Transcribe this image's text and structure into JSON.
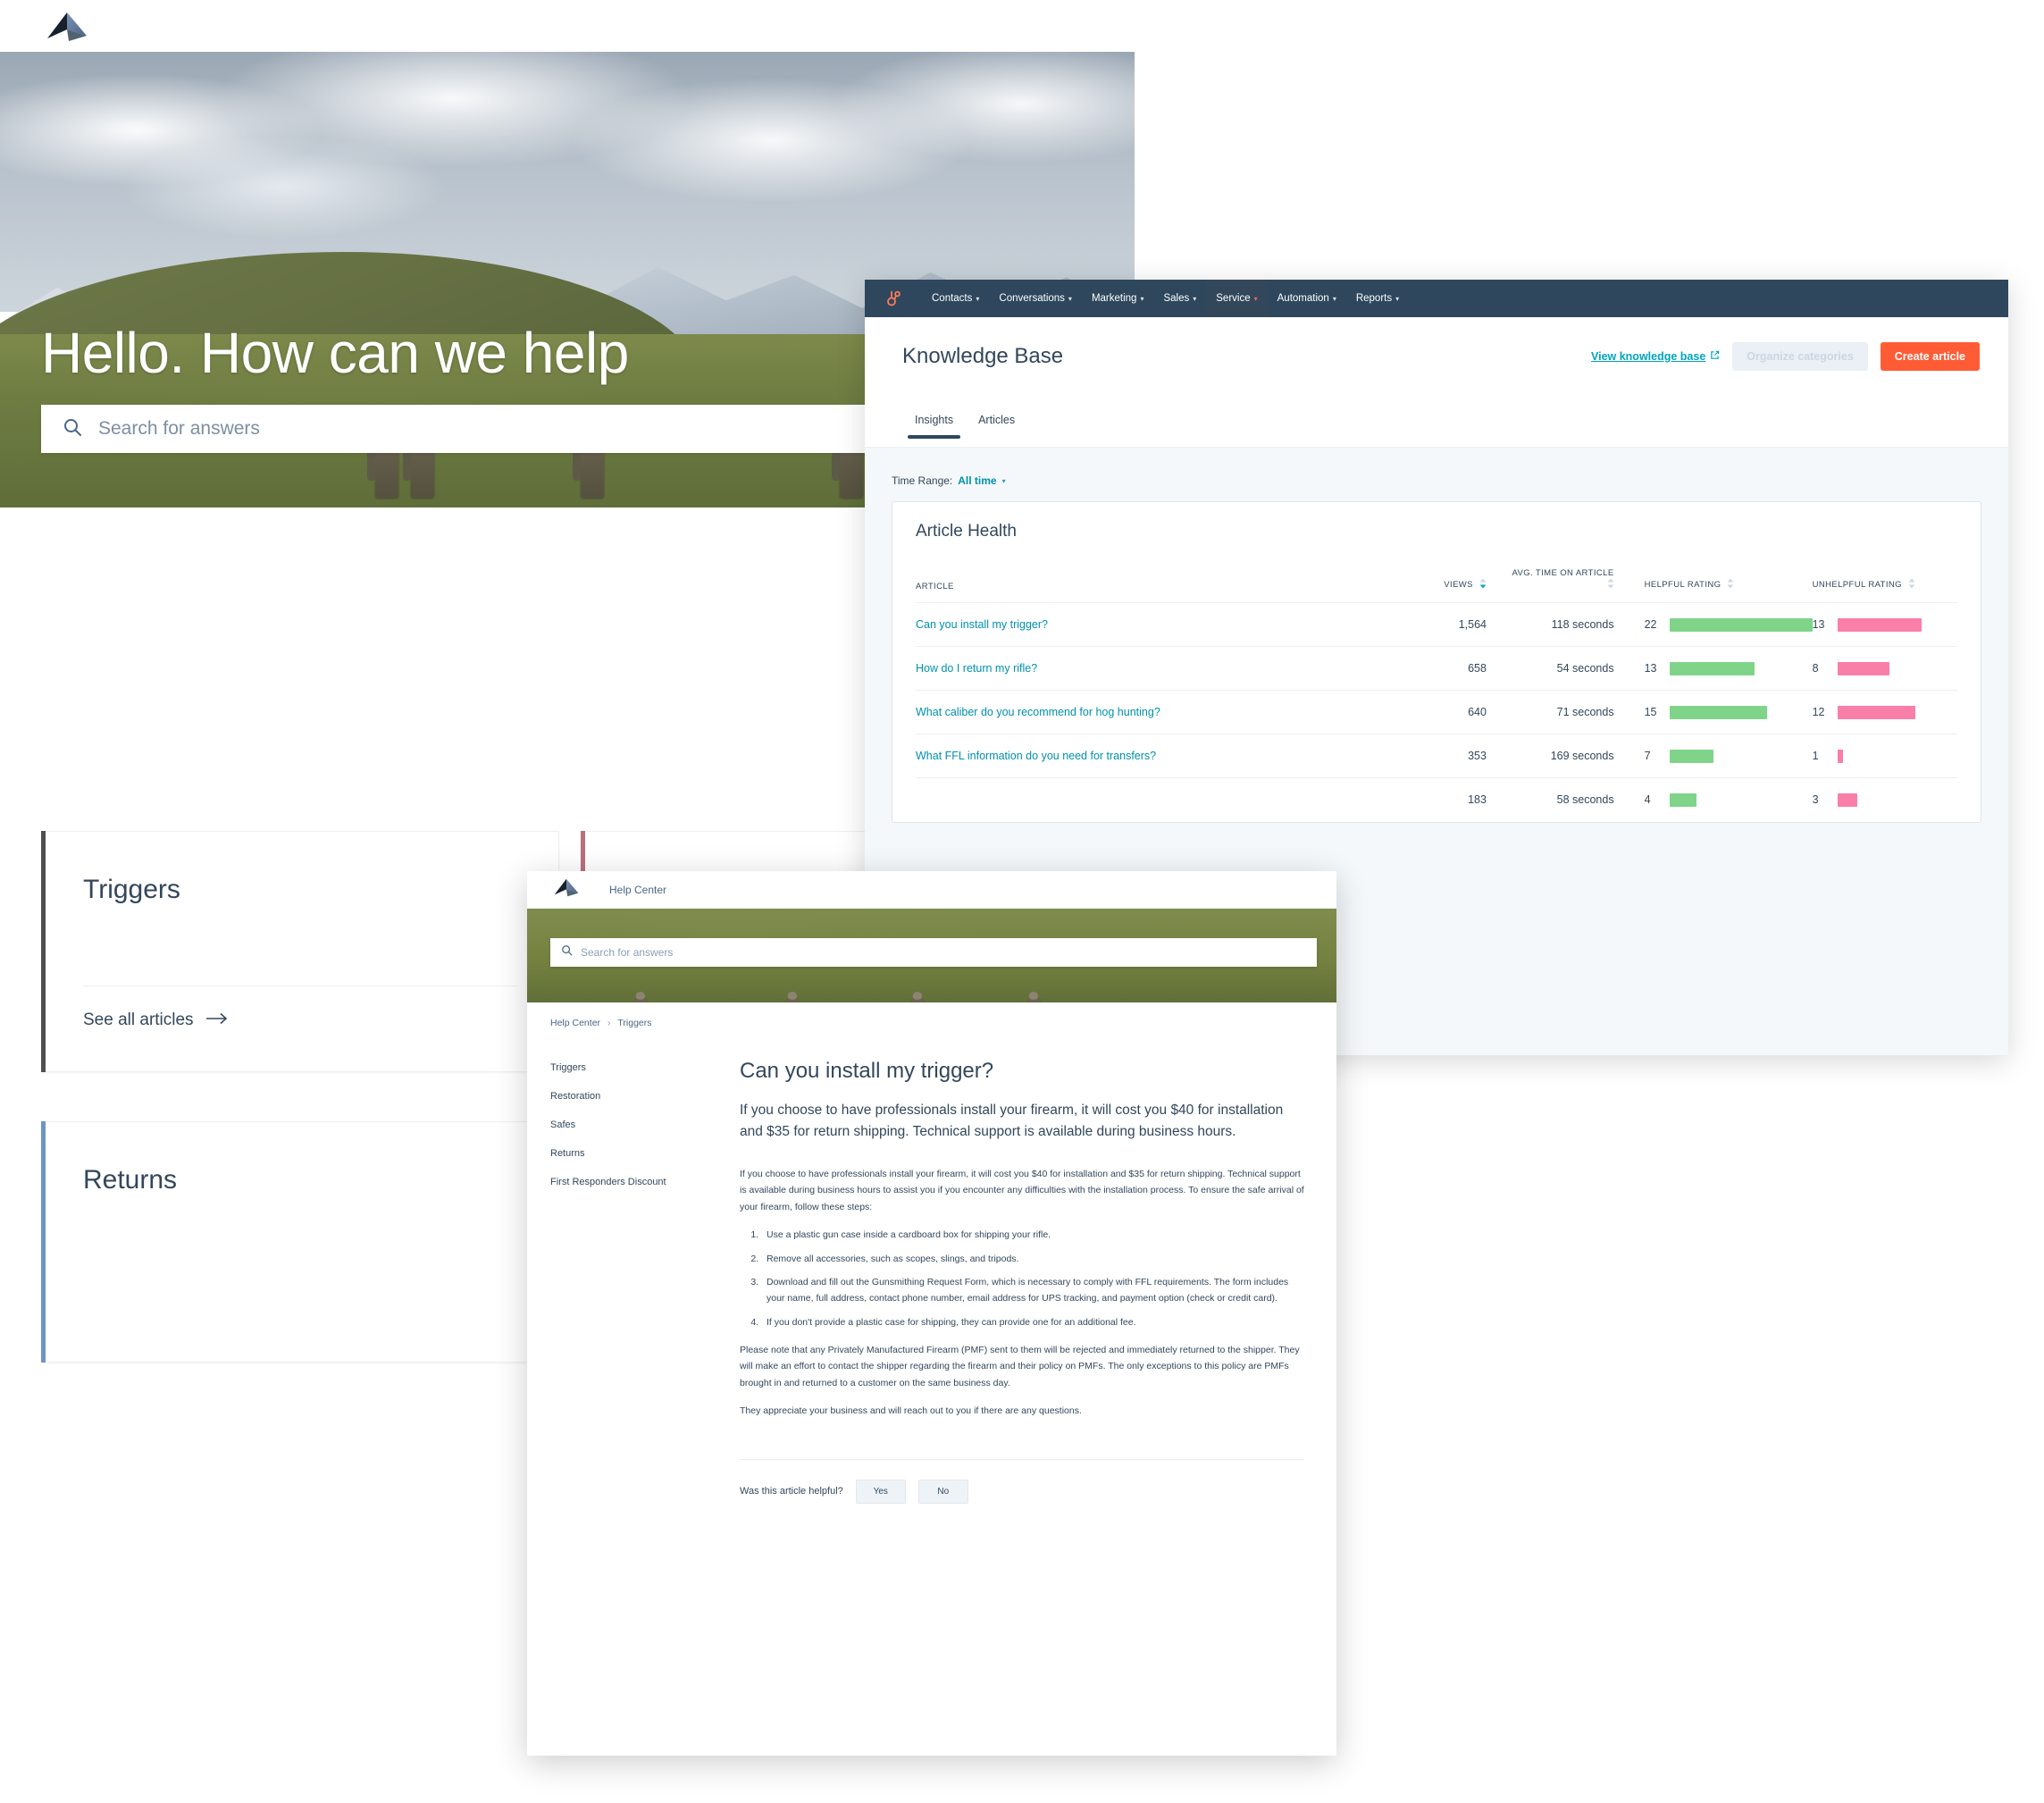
{
  "help_center_site": {
    "logo_icon": "paper-plane-logo",
    "hero": {
      "title": "Hello. How can we help",
      "search_placeholder": "Search for answers",
      "search_icon": "search-icon"
    },
    "category_cards": [
      {
        "title": "Triggers",
        "accent": "#4f4f4f",
        "link_label": "See all articles",
        "link_icon": "arrow-right-icon"
      },
      {
        "title": "Returns",
        "accent": "#6e95c4",
        "link_label": "",
        "link_icon": ""
      }
    ],
    "partial_card_accent": "#b9707c"
  },
  "hubspot_app": {
    "logo_icon": "hubspot-sprocket-icon",
    "nav_items": [
      {
        "label": "Contacts",
        "active": false
      },
      {
        "label": "Conversations",
        "active": false
      },
      {
        "label": "Marketing",
        "active": false
      },
      {
        "label": "Sales",
        "active": false
      },
      {
        "label": "Service",
        "active": true
      },
      {
        "label": "Automation",
        "active": false
      },
      {
        "label": "Reports",
        "active": false
      }
    ],
    "page_title": "Knowledge Base",
    "actions": {
      "view_kb_label": "View knowledge base",
      "view_kb_icon": "external-link-icon",
      "organize_label": "Organize categories",
      "create_label": "Create article",
      "create_color": "#ff5c35",
      "link_color": "#00a4bd"
    },
    "tabs": [
      {
        "label": "Insights",
        "active": true
      },
      {
        "label": "Articles",
        "active": false
      }
    ],
    "time_range": {
      "label": "Time Range:",
      "value": "All time",
      "caret_icon": "caret-down-icon"
    },
    "card_title": "Article Health"
  },
  "chart_data": {
    "type": "table",
    "title": "Article Health",
    "columns": [
      "ARTICLE",
      "VIEWS",
      "AVG. TIME ON ARTICLE",
      "HELPFUL RATING",
      "UNHELPFUL RATING"
    ],
    "sort": {
      "column": "VIEWS",
      "direction": "desc"
    },
    "rows": [
      {
        "article": "Can you install my trigger?",
        "views": "1,564",
        "avg_time": "118 seconds",
        "helpful": 22,
        "unhelpful": 13
      },
      {
        "article": "How do I return my rifle?",
        "views": "658",
        "avg_time": "54 seconds",
        "helpful": 13,
        "unhelpful": 8
      },
      {
        "article": "What caliber do you recommend for hog hunting?",
        "views": "640",
        "avg_time": "71 seconds",
        "helpful": 15,
        "unhelpful": 12
      },
      {
        "article": "What FFL information do you need for transfers?",
        "views": "353",
        "avg_time": "169 seconds",
        "helpful": 7,
        "unhelpful": 1
      },
      {
        "article": "",
        "views": "183",
        "avg_time": "58 seconds",
        "helpful": 4,
        "unhelpful": 3
      }
    ],
    "helpful_max": 22,
    "unhelpful_max": 13,
    "helpful_color": "#7fd48a",
    "unhelpful_color": "#f97fa8",
    "link_color": "#0091ae"
  },
  "article_page": {
    "logo_icon": "paper-plane-logo",
    "brand_label": "Help Center",
    "search_placeholder": "Search for answers",
    "search_icon": "search-icon",
    "breadcrumb": {
      "root": "Help Center",
      "separator_icon": "chevron-right-icon",
      "current": "Triggers"
    },
    "sidebar_items": [
      {
        "label": "Triggers"
      },
      {
        "label": "Restoration"
      },
      {
        "label": "Safes"
      },
      {
        "label": "Returns"
      },
      {
        "label": "First Responders Discount"
      }
    ],
    "heading": "Can you install my trigger?",
    "lede": "If you choose to have professionals install your firearm, it will cost you $40 for installation and $35 for return shipping. Technical support is available during business hours.",
    "paragraph_1": "If you choose to have professionals install your firearm, it will cost you $40 for installation and $35 for return shipping. Technical support is available during business hours to assist you if you encounter any difficulties with the installation process. To ensure the safe arrival of your firearm, follow these steps:",
    "steps": [
      "Use a plastic gun case inside a cardboard box for shipping your rifle.",
      "Remove all accessories, such as scopes, slings, and tripods.",
      "Download and fill out the Gunsmithing Request Form, which is necessary to comply with FFL requirements. The form includes your name, full address, contact phone number, email address for UPS tracking, and payment option (check or credit card).",
      "If you don't provide a plastic case for shipping, they can provide one for an additional fee."
    ],
    "paragraph_2": "Please note that any Privately Manufactured Firearm (PMF) sent to them will be rejected and immediately returned to the shipper. They will make an effort to contact the shipper regarding the firearm and their policy on PMFs. The only exceptions to this policy are PMFs brought in and returned to a customer on the same business day.",
    "paragraph_3": "They appreciate your business and will reach out to you if there are any questions.",
    "feedback": {
      "question": "Was this article helpful?",
      "yes_label": "Yes",
      "no_label": "No"
    }
  }
}
